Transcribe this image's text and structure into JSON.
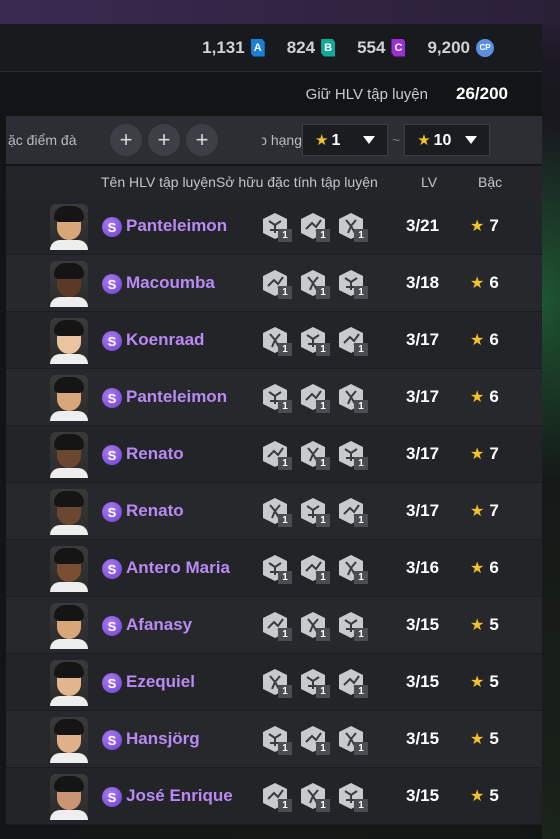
{
  "currency": [
    {
      "value": "1,131",
      "badge": "A",
      "color": "#1b7fd6"
    },
    {
      "value": "824",
      "badge": "B",
      "color": "#13a89a"
    },
    {
      "value": "554",
      "badge": "C",
      "color": "#9b2fd6"
    },
    {
      "value": "9,200",
      "badge": "CP",
      "color": "#5b8fe0"
    }
  ],
  "hold": {
    "label": "Giữ HLV tập luyện",
    "value": "26/200"
  },
  "filters": {
    "trait_label": "ặc điểm đà",
    "rank_label": "p hạng",
    "plus": "+",
    "min_grade": "1",
    "max_grade": "10",
    "separator": "~"
  },
  "headers": {
    "name": "Tên HLV tập luyện",
    "traits": "Sở hữu đặc tính tập luyện",
    "lv": "LV",
    "grade": "Bậc"
  },
  "star": "★",
  "s_badge": "S",
  "coaches": [
    {
      "name": "Panteleimon",
      "lv": "3/21",
      "grade": "7",
      "skin": "#d9a67a",
      "traits": [
        "1",
        "1",
        "1"
      ]
    },
    {
      "name": "Macoumba",
      "lv": "3/18",
      "grade": "6",
      "skin": "#5a3a26",
      "traits": [
        "1",
        "1",
        "1"
      ]
    },
    {
      "name": "Koenraad",
      "lv": "3/17",
      "grade": "6",
      "skin": "#eac3a0",
      "traits": [
        "1",
        "1",
        "1"
      ]
    },
    {
      "name": "Panteleimon",
      "lv": "3/17",
      "grade": "6",
      "skin": "#d9a67a",
      "traits": [
        "1",
        "1",
        "1"
      ]
    },
    {
      "name": "Renato",
      "lv": "3/17",
      "grade": "7",
      "skin": "#6b4630",
      "traits": [
        "1",
        "1",
        "1"
      ]
    },
    {
      "name": "Renato",
      "lv": "3/17",
      "grade": "7",
      "skin": "#6b4630",
      "traits": [
        "1",
        "1",
        "1"
      ]
    },
    {
      "name": "Antero Maria",
      "lv": "3/16",
      "grade": "6",
      "skin": "#7a4e33",
      "traits": [
        "1",
        "1",
        "1"
      ]
    },
    {
      "name": "Afanasy",
      "lv": "3/15",
      "grade": "5",
      "skin": "#d9a67a",
      "traits": [
        "1",
        "1",
        "1"
      ]
    },
    {
      "name": "Ezequiel",
      "lv": "3/15",
      "grade": "5",
      "skin": "#e2b58f",
      "traits": [
        "1",
        "1",
        "1"
      ]
    },
    {
      "name": "Hansjörg",
      "lv": "3/15",
      "grade": "5",
      "skin": "#e0b08a",
      "traits": [
        "1",
        "1",
        "1"
      ]
    },
    {
      "name": "José Enrique",
      "lv": "3/15",
      "grade": "5",
      "skin": "#c99572",
      "traits": [
        "1",
        "1",
        "1"
      ]
    }
  ]
}
